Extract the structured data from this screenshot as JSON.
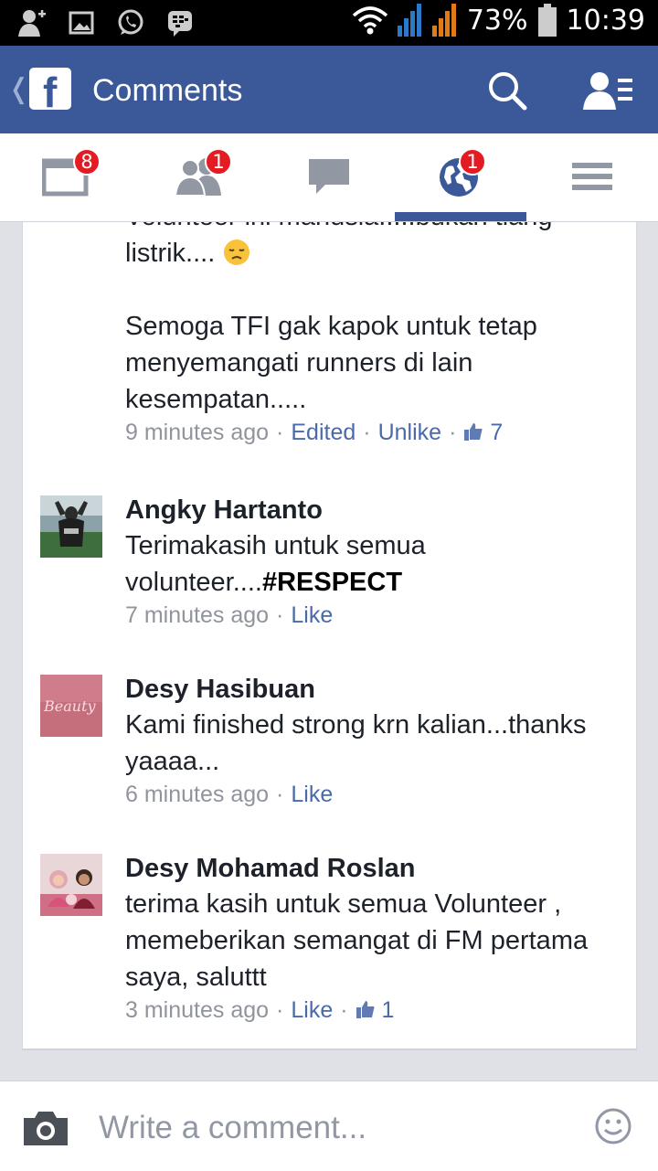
{
  "status_bar": {
    "battery": "73%",
    "time": "10:39",
    "icons": [
      "add-friend-notification-icon",
      "image-notification-icon",
      "whatsapp-icon",
      "bbm-icon",
      "wifi-icon",
      "signal-icon",
      "signal-icon",
      "battery-icon"
    ]
  },
  "header": {
    "title": "Comments",
    "icons": [
      "back-chevron-icon",
      "facebook-logo-icon",
      "search-icon",
      "friend-requests-icon"
    ],
    "color": "#3b5998"
  },
  "tabs": [
    {
      "name": "news-feed",
      "icon": "news-feed-icon",
      "badge": "8"
    },
    {
      "name": "friend-requests",
      "icon": "friends-icon",
      "badge": "1"
    },
    {
      "name": "messages",
      "icon": "message-icon",
      "badge": ""
    },
    {
      "name": "notifications",
      "icon": "globe-icon",
      "badge": "1",
      "active": true
    },
    {
      "name": "more",
      "icon": "menu-icon",
      "badge": ""
    }
  ],
  "first_comment": {
    "partial_line": "Volunteer ini manusia.....bukan tiang",
    "line2": "listrik....",
    "emoji": "disappointed-face-icon",
    "paragraph2": "Semoga TFI gak kapok untuk tetap menyemangati runners di lain kesempatan.....",
    "time": "9 minutes ago",
    "edited": "Edited",
    "action": "Unlike",
    "likes": "7"
  },
  "comments": [
    {
      "author": "Angky Hartanto",
      "text_prefix": "Terimakasih untuk semua volunteer....",
      "hashtag": "#RESPECT",
      "time": "7 minutes ago",
      "action": "Like",
      "likes": ""
    },
    {
      "author": "Desy Hasibuan",
      "text": "Kami finished strong krn kalian...thanks yaaaa...",
      "avatar_text": "Beauty",
      "time": "6 minutes ago",
      "action": "Like",
      "likes": ""
    },
    {
      "author": "Desy Mohamad Roslan",
      "text": "terima kasih untuk semua Volunteer , memeberikan semangat  di FM pertama saya, saluttt",
      "time": "3 minutes ago",
      "action": "Like",
      "likes": "1"
    }
  ],
  "composer": {
    "placeholder": "Write a comment...",
    "icons": [
      "camera-icon",
      "smiley-icon"
    ]
  }
}
